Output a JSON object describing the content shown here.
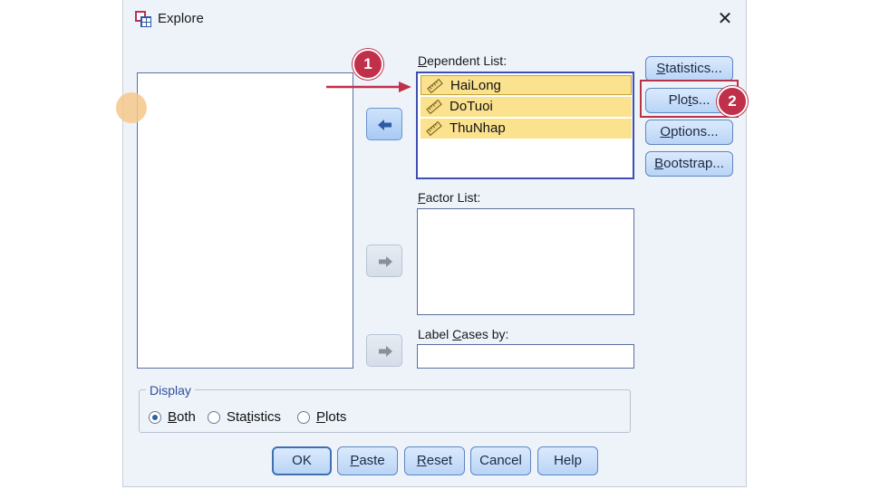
{
  "window": {
    "title": "Explore",
    "close_glyph": "✕"
  },
  "available_variables": [],
  "dependent_list": {
    "label_prefix": "",
    "label_underlined": "D",
    "label_rest": "ependent List:",
    "items": [
      {
        "name": "HaiLong",
        "icon": "ruler-icon"
      },
      {
        "name": "DoTuoi",
        "icon": "ruler-icon"
      },
      {
        "name": "ThuNhap",
        "icon": "ruler-icon"
      }
    ]
  },
  "factor_list": {
    "label_underlined": "F",
    "label_rest": "actor List:",
    "items": []
  },
  "label_cases": {
    "label_pre": "Label ",
    "label_underlined": "C",
    "label_rest": "ases by:",
    "value": ""
  },
  "side_buttons": [
    {
      "id": "statistics",
      "pre": "",
      "u": "S",
      "rest": "tatistics..."
    },
    {
      "id": "plots",
      "pre": "Plo",
      "u": "t",
      "rest": "s..."
    },
    {
      "id": "options",
      "pre": "",
      "u": "O",
      "rest": "ptions..."
    },
    {
      "id": "bootstrap",
      "pre": "",
      "u": "B",
      "rest": "ootstrap..."
    }
  ],
  "display": {
    "legend": "Display",
    "options": [
      {
        "pre": "",
        "u": "B",
        "rest": "oth",
        "checked": true
      },
      {
        "pre": "Sta",
        "u": "t",
        "rest": "istics",
        "checked": false
      },
      {
        "pre": "",
        "u": "P",
        "rest": "lots",
        "checked": false
      }
    ]
  },
  "bottom_buttons": [
    {
      "id": "ok",
      "pre": "OK",
      "u": "",
      "rest": ""
    },
    {
      "id": "paste",
      "pre": "",
      "u": "P",
      "rest": "aste"
    },
    {
      "id": "reset",
      "pre": "",
      "u": "R",
      "rest": "eset"
    },
    {
      "id": "cancel",
      "pre": "Cancel",
      "u": "",
      "rest": ""
    },
    {
      "id": "help",
      "pre": "Help",
      "u": "",
      "rest": ""
    }
  ],
  "annotations": {
    "step1": "1",
    "step2": "2"
  },
  "colors": {
    "accent": "#5d86c4",
    "annotation": "#c0304a",
    "selection": "#fbe28f"
  }
}
